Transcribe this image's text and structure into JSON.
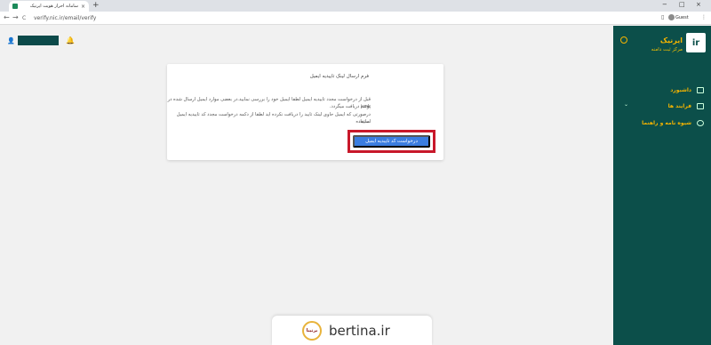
{
  "browser": {
    "tab_title": "سامانه احراز هویت ایرنیک",
    "tab_close": "×",
    "new_tab": "+",
    "url": "verify.nic.ir/email/verify",
    "nav_back": "←",
    "nav_forward": "→",
    "nav_reload": "C",
    "profile_label": "Guest",
    "window_controls": [
      "−",
      "□",
      "×"
    ]
  },
  "topbar": {
    "bell_icon": "bell-icon"
  },
  "sidebar": {
    "brand_title": "ایرنیک",
    "brand_subtitle": "مرکز ثبت دامنه",
    "items": [
      {
        "label": "داشبورد",
        "icon": "monitor-icon"
      },
      {
        "label": "فرایند ها",
        "icon": "document-icon",
        "chevron": "⌄"
      },
      {
        "label": "شیوه نامه و راهنما",
        "icon": "help-icon"
      }
    ]
  },
  "card": {
    "title": "فرم ارسال لینک تاییدیه ایمیل",
    "paragraph_lines": [
      "قبل از درخواست مجدد تاییدیه ایمیل لطفا ایمیل خود را بررسی نمایید.در بعضی موارد ایمیل ارسال شده در پوشه",
      "junk دریافت میگردد.",
      "درصورتی که ایمیل حاوی لینک تایید را دریافت نکرده اید لطفا از دکمه درخواست مجدد کد تاییدیه ایمیل استفاده",
      "نمایید."
    ],
    "action_button": "درخواست کد تاییدیه ایمیل"
  },
  "watermark": {
    "text": "bertina.ir",
    "logo_text": "برتینا"
  }
}
